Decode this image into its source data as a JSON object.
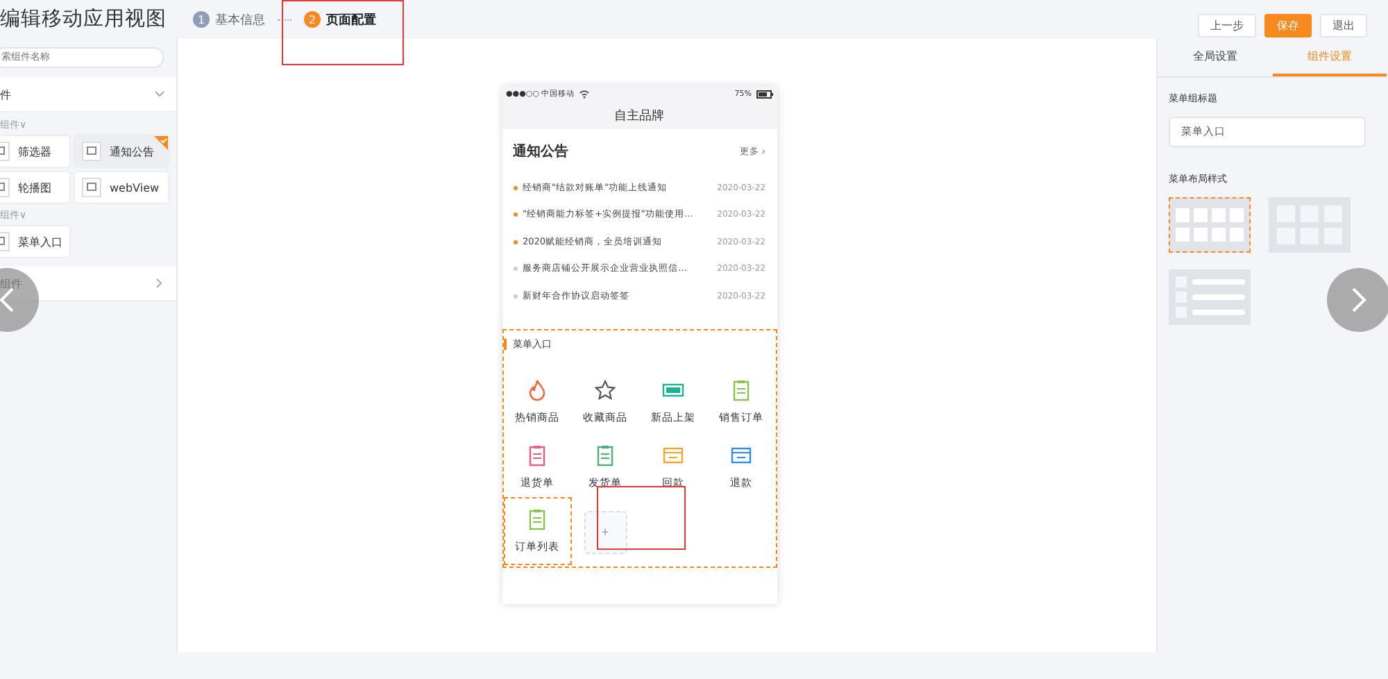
{
  "header": {
    "title": "编辑移动应用视图",
    "steps": [
      {
        "number": "1",
        "label": "基本信息",
        "selected": false
      },
      {
        "number": "2",
        "label": "页面配置",
        "selected": true
      }
    ],
    "buttons": [
      {
        "label": "上一步",
        "primary": false
      },
      {
        "label": "保存",
        "primary": true
      },
      {
        "label": "退出",
        "primary": false
      }
    ]
  },
  "left_panel": {
    "search": {
      "placeholder": "索组件名称"
    },
    "section": {
      "label": "件",
      "expanded": true
    },
    "groups": [
      {
        "label": "组件∨",
        "items": [
          {
            "label": "筛选器",
            "selected": false
          },
          {
            "label": "通知公告",
            "selected": true
          },
          {
            "label": "轮播图",
            "selected": false
          },
          {
            "label": "webView",
            "selected": false
          }
        ]
      },
      {
        "label": "组件∨",
        "items": [
          {
            "label": "菜单入口",
            "selected": false
          }
        ]
      }
    ],
    "collapsed_section": {
      "label": "组件",
      "expanded": false
    }
  },
  "phone": {
    "status_bar": {
      "carrier": "●●●○○ 中国移动",
      "battery": "75%"
    },
    "title": "自主品牌",
    "notices": {
      "title": "通知公告",
      "more": "更多 ›",
      "items": [
        {
          "text": "经销商\"结款对账单\"功能上线通知",
          "date": "2020-03-22",
          "unread": true
        },
        {
          "text": "\"经销商能力标签+实例提报\"功能使用…",
          "date": "2020-03-22",
          "unread": true
        },
        {
          "text": "2020赋能经销商，全员培训通知",
          "date": "2020-03-22",
          "unread": true
        },
        {
          "text": "服务商店铺公开展示企业营业执照信…",
          "date": "2020-03-22",
          "unread": false
        },
        {
          "text": "新财年合作协议启动签签",
          "date": "2020-03-22",
          "unread": false
        }
      ]
    },
    "menu": {
      "title": "菜单入口",
      "items": [
        {
          "label": "热销商品"
        },
        {
          "label": "收藏商品"
        },
        {
          "label": "新品上架"
        },
        {
          "label": "销售订单"
        },
        {
          "label": "退货单"
        },
        {
          "label": "发货单"
        },
        {
          "label": "回款"
        },
        {
          "label": "退款"
        },
        {
          "label": "订单列表"
        }
      ],
      "add": "+"
    }
  },
  "right_panel": {
    "tabs": [
      {
        "label": "全局设置",
        "selected": false
      },
      {
        "label": "组件设置",
        "selected": true
      }
    ],
    "title_label": "菜单组标题",
    "title_value": "菜单入口",
    "layout_label": "菜单布局样式",
    "layouts": [
      {
        "kind": "grid4",
        "selected": true
      },
      {
        "kind": "grid3",
        "selected": false
      },
      {
        "kind": "list",
        "selected": false
      }
    ]
  }
}
